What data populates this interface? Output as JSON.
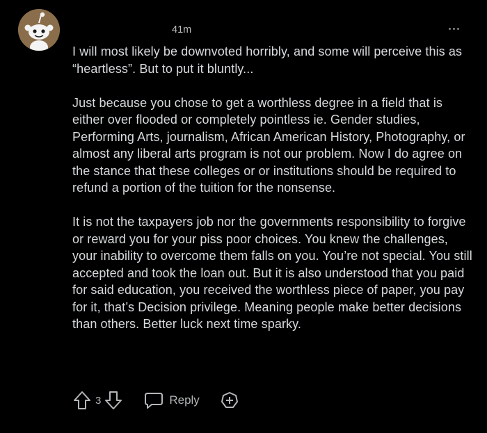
{
  "comment": {
    "timestamp": "41m",
    "paragraphs": [
      "I will most likely be downvoted horribly, and some will perceive this as “heartless”. But to put it bluntly...",
      "Just because you chose to get a worthless degree in a field that is either over flooded or completely pointless ie. Gender studies, Performing Arts, journalism, African American History, Photography, or almost any liberal arts program is not our problem. Now I do agree on the stance that these colleges or or institutions should be required to refund a portion of the tuition for the nonsense.",
      "It is not the taxpayers job nor the governments responsibility to forgive or reward you for your piss poor choices. You knew the challenges, your inability to overcome them falls on you. You’re not special. You still accepted and took the loan out. But it is also understood that you paid for said education, you received the worthless piece of paper, you pay for it, that’s Decision privilege. Meaning people make better decisions than others. Better luck next time sparky."
    ]
  },
  "actions": {
    "score": "3",
    "reply_label": "Reply"
  },
  "icons": {
    "avatar": "snoo-avatar-icon",
    "more": "more-options-icon",
    "upvote": "upvote-arrow-icon",
    "downvote": "downvote-arrow-icon",
    "reply": "speech-bubble-icon",
    "award": "award-plus-icon"
  },
  "colors": {
    "background": "#000000",
    "text": "#d7dadc",
    "muted": "#b4b7b9",
    "avatar_bg": "#8a6e4b"
  }
}
